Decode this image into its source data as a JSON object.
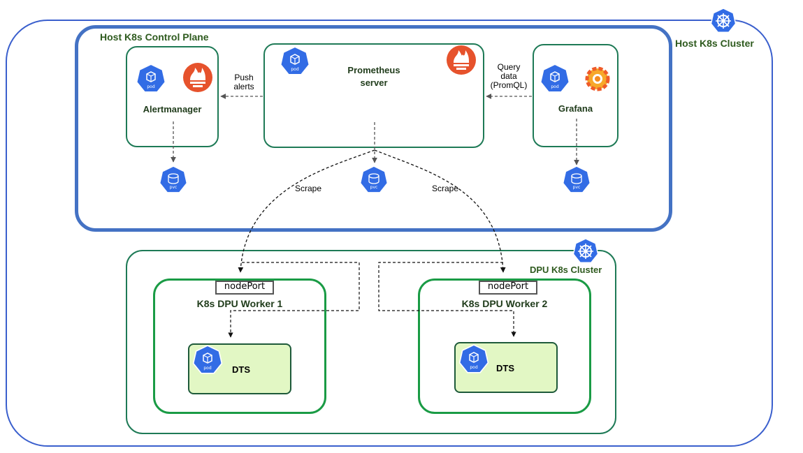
{
  "host_cluster": {
    "title": "Host K8s Cluster",
    "icon": "kubernetes-helm-icon"
  },
  "control_plane": {
    "title": "Host K8s Control Plane"
  },
  "alertmanager": {
    "label": "Alertmanager",
    "pod_icon_text": "pod",
    "logo": "prometheus-logo-icon"
  },
  "prometheus": {
    "label_line1": "Prometheus",
    "label_line2": "server",
    "pod_icon_text": "pod",
    "logo": "prometheus-logo-icon"
  },
  "grafana": {
    "label": "Grafana",
    "pod_icon_text": "pod",
    "logo": "grafana-logo-icon"
  },
  "pvc_icon_text": "pvc",
  "edges": {
    "push_alerts_line1": "Push",
    "push_alerts_line2": "alerts",
    "query_line1": "Query",
    "query_line2": "data",
    "query_line3": "(PromQL)",
    "scrape_left": "Scrape",
    "scrape_right": "Scrape"
  },
  "dpu_cluster": {
    "title": "DPU K8s Cluster",
    "icon": "kubernetes-helm-icon"
  },
  "workers": [
    {
      "title": "K8s DPU Worker 1",
      "node_port": "nodePort",
      "dts_label": "DTS",
      "pod_icon_text": "pod"
    },
    {
      "title": "K8s DPU Worker 2",
      "node_port": "nodePort",
      "dts_label": "DTS",
      "pod_icon_text": "pod"
    }
  ],
  "colors": {
    "host_cluster_border": "#3a5fcd",
    "control_plane_border": "#4472c4",
    "container_border": "#1e7a56",
    "worker_border": "#1a9b45",
    "dts_fill": "#e2f7c4",
    "k8s_blue": "#326ce5",
    "prometheus_orange": "#e6522c",
    "title_green": "#2e5a1e"
  }
}
